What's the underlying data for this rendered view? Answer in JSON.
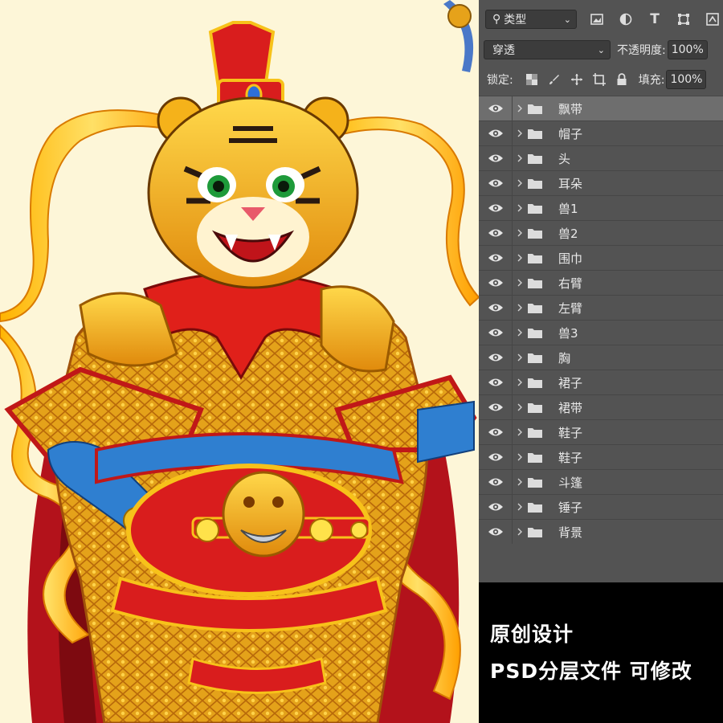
{
  "panel": {
    "filter_kind": "类型",
    "blend_mode": "穿透",
    "opacity_label": "不透明度:",
    "opacity_value": "100%",
    "lock_label": "锁定:",
    "fill_label": "填充:",
    "fill_value": "100%",
    "layers": [
      "飘带",
      "帽子",
      "头",
      "耳朵",
      "兽1",
      "兽2",
      "围巾",
      "右臂",
      "左臂",
      "兽3",
      "胸",
      "裙子",
      "裙带",
      "鞋子",
      "鞋子",
      "斗篷",
      "锤子",
      "背景"
    ],
    "selected_layer": 0
  },
  "promo": {
    "line1": "原创设计",
    "line2": "PSD分层文件 可修改"
  },
  "colors": {
    "panel_bg": "#535353",
    "selected_row": "#6e6e6e",
    "canvas_bg": "#fdf6d8",
    "promo_bg": "#000000"
  }
}
